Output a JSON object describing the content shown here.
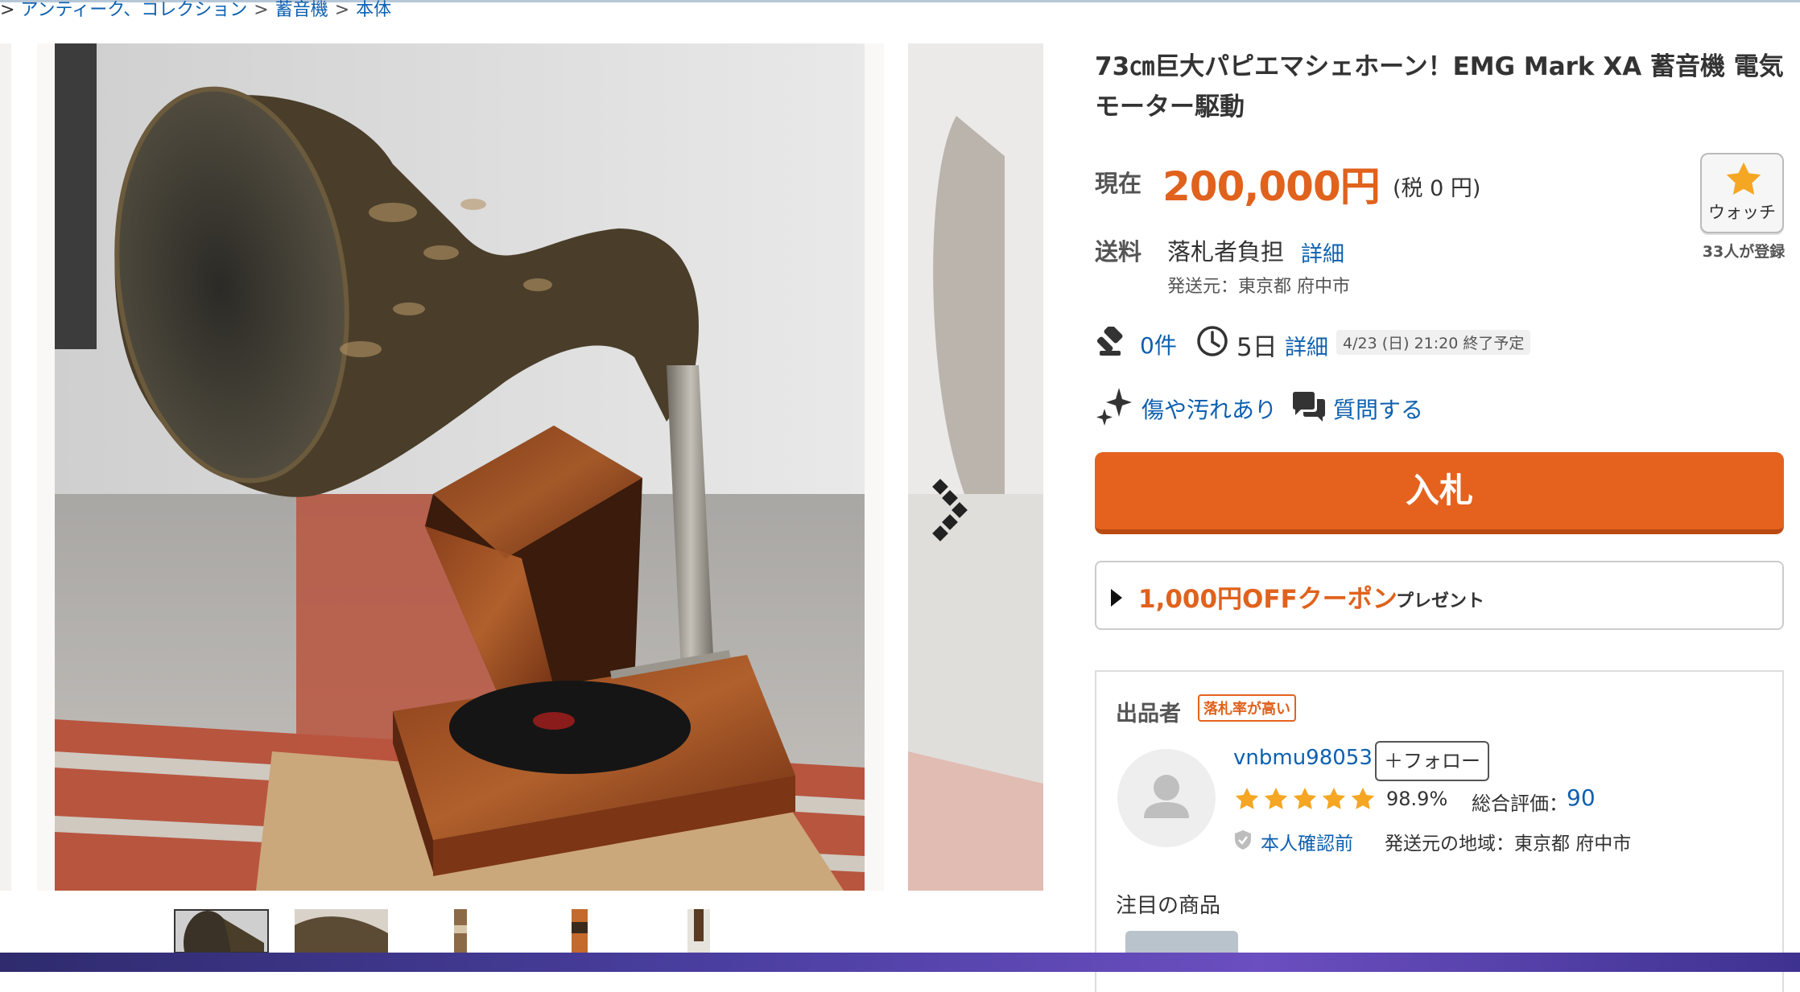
{
  "breadcrumb": {
    "lead": ">",
    "items": [
      "アンティーク、コレクション",
      "蓄音機",
      "本体"
    ],
    "separator": ">"
  },
  "item": {
    "title": "73㎝巨大パピエマシェホーン！EMG Mark XA 蓄音機 電気モーター駆動",
    "price_label": "現在",
    "price": "200,000円",
    "tax": "(税 0 円)",
    "watch_label": "ウォッチ",
    "watch_count": "33人が登録",
    "shipping_label": "送料",
    "shipping_value": "落札者負担",
    "shipping_detail": "詳細",
    "ship_from": "発送元：東京都 府中市",
    "bid_count": "0件",
    "remaining": "5日",
    "remaining_detail": "詳細",
    "end_time": "4/23 (日) 21:20 終了予定",
    "condition": "傷や汚れあり",
    "question": "質問する",
    "bid_button": "入札",
    "coupon_amount": "1,000円OFFクーポン",
    "coupon_suffix": "プレゼント"
  },
  "seller": {
    "label": "出品者",
    "badge": "落札率が高い",
    "name": "vnbmu98053",
    "follow": "＋フォロー",
    "rating_stars": 5,
    "rating_pct": "98.9%",
    "total_label": "総合評価：",
    "total_value": "90",
    "verify": "本人確認前",
    "region": "発送元の地域：東京都 府中市",
    "featured": "注目の商品"
  },
  "colors": {
    "accent": "#e5621e",
    "link": "#0d60b0",
    "star": "#f5a623"
  }
}
